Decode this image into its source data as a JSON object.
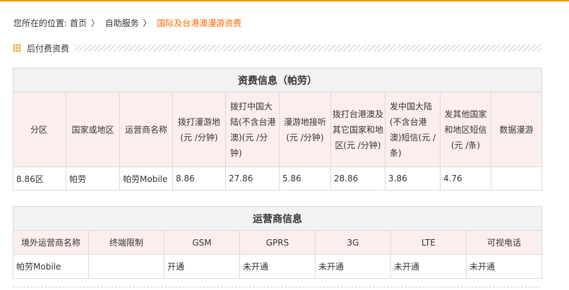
{
  "breadcrumb": {
    "prefix": "您所在的位置:",
    "home": "首页",
    "sep": "〉",
    "self_service": "自助服务",
    "current": "国际及台港澳漫游资费"
  },
  "section": {
    "title": "后付费资费"
  },
  "fee_table": {
    "caption": "资费信息（帕劳）",
    "headers": [
      "分区",
      "国家或地区",
      "运营商名称",
      "拨打漫游地(元 /分钟)",
      "拨打中国大陆(不含台港澳)(元 /分钟)",
      "漫游地接听(元 /分钟)",
      "拨打台港澳及其它国家和地区(元 /分钟)",
      "发中国大陆(不含台港澳)短信(元 /条)",
      "发其他国家和地区短信(元 /条)",
      "数据漫游"
    ],
    "row": [
      "8.86区",
      "帕劳",
      "帕劳Mobile",
      "8.86",
      "27.86",
      "5.86",
      "28.86",
      "3.86",
      "4.76",
      ""
    ]
  },
  "operator_table": {
    "caption": "运营商信息",
    "headers": [
      "境外运营商名称",
      "终端限制",
      "GSM",
      "GPRS",
      "3G",
      "LTE",
      "可视电话"
    ],
    "row": [
      "帕劳Mobile",
      "",
      "开通",
      "未开通",
      "未开通",
      "未开通",
      "未开通"
    ]
  },
  "colors": {
    "accent": "#f39800",
    "current_link": "#ff6600",
    "header_bg": "#fdeeee",
    "caption_bg": "#f2f2f2"
  }
}
